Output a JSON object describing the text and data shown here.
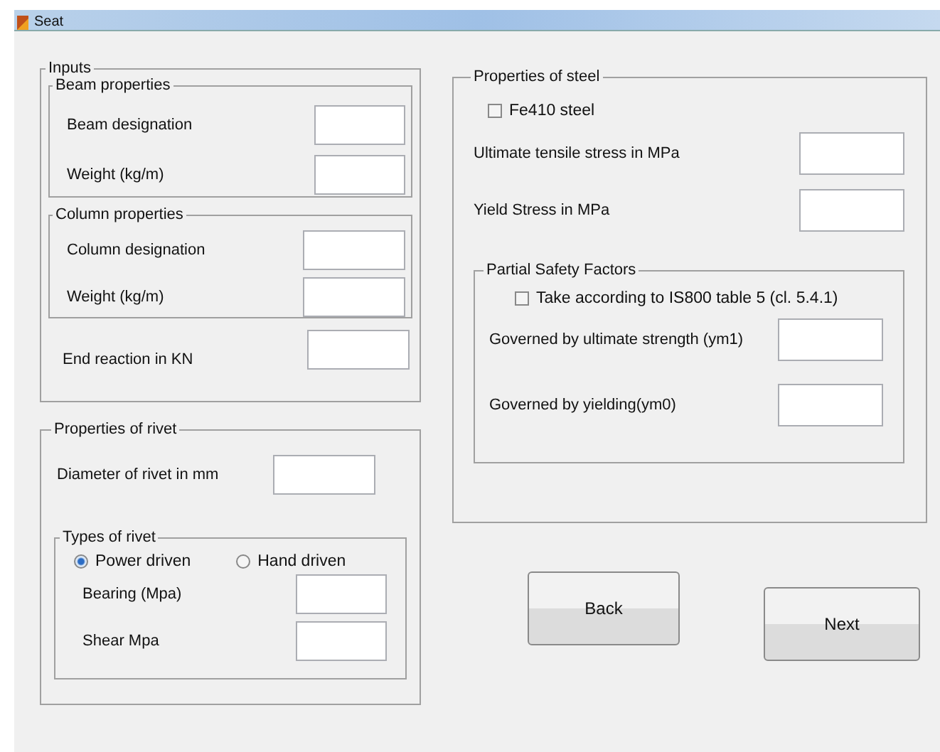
{
  "window": {
    "title": "Seat"
  },
  "inputs": {
    "title": "Inputs",
    "beam": {
      "title": "Beam properties",
      "fields": [
        {
          "label": "Beam designation"
        },
        {
          "label": "Weight (kg/m)"
        }
      ]
    },
    "column": {
      "title": "Column properties",
      "fields": [
        {
          "label": "Column designation"
        },
        {
          "label": "Weight (kg/m)"
        }
      ]
    },
    "end_reaction": {
      "label": "End reaction in KN"
    }
  },
  "rivet": {
    "title": "Properties of rivet",
    "diameter": {
      "label": "Diameter of rivet in mm"
    },
    "types": {
      "title": "Types of rivet",
      "options": [
        {
          "label": "Power driven",
          "selected": true
        },
        {
          "label": "Hand driven",
          "selected": false
        }
      ],
      "fields": [
        {
          "label": "Bearing (Mpa)"
        },
        {
          "label": "Shear Mpa"
        }
      ]
    }
  },
  "steel": {
    "title": "Properties of steel",
    "fe410": {
      "label": "Fe410 steel",
      "checked": false
    },
    "fields": [
      {
        "label": "Ultimate tensile stress in MPa"
      },
      {
        "label": "Yield Stress in MPa"
      }
    ],
    "safety": {
      "title": "Partial Safety Factors",
      "take": {
        "label": "Take according to IS800 table 5 (cl. 5.4.1)",
        "checked": false
      },
      "fields": [
        {
          "label": "Governed by ultimate strength (ym1)"
        },
        {
          "label": "Governed by yielding(ym0)"
        }
      ]
    }
  },
  "buttons": [
    {
      "label": "Back"
    },
    {
      "label": "Next"
    }
  ]
}
